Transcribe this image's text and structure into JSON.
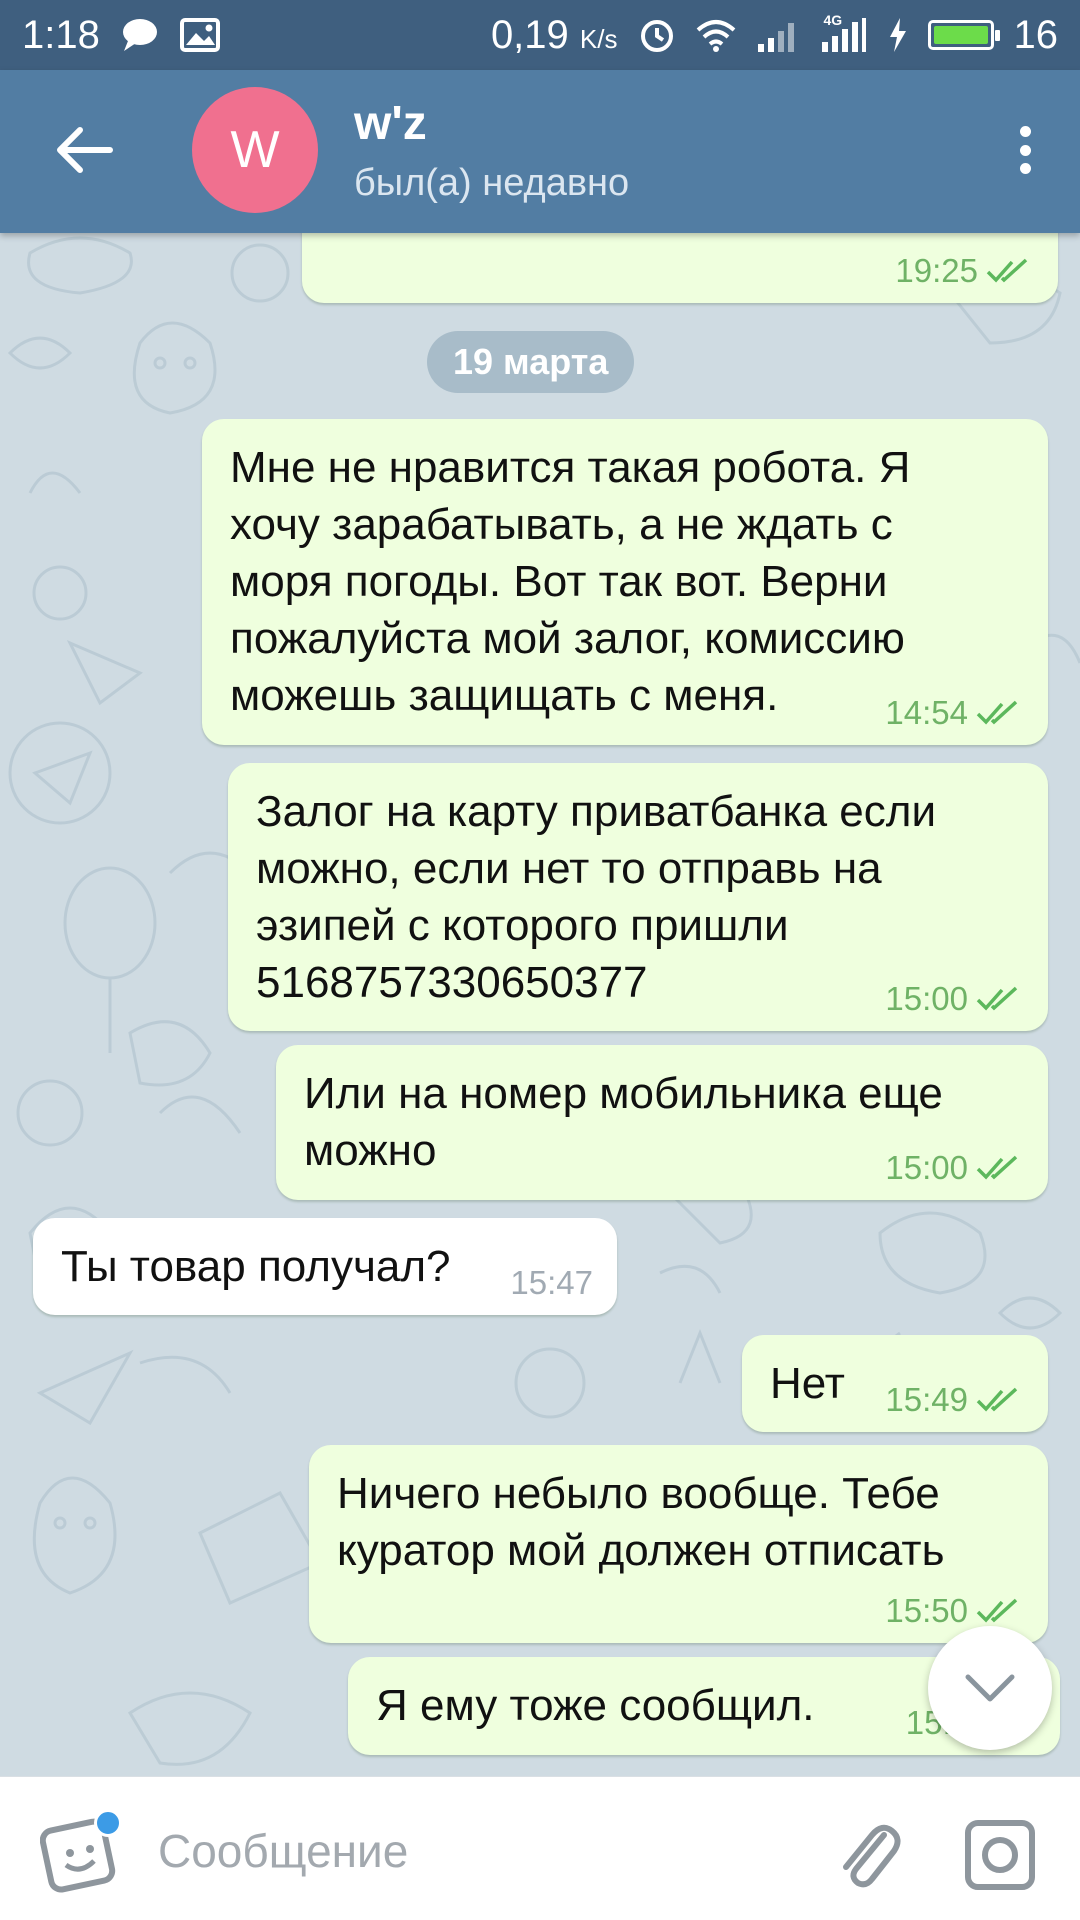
{
  "status_bar": {
    "time": "1:18",
    "network_speed": "0,19",
    "speed_unit": "K/s",
    "signal_label": "4G",
    "battery_level": "16",
    "battery_fraction": 0.16
  },
  "header": {
    "avatar_letter": "W",
    "contact_name": "w'z",
    "contact_status": "был(а) недавно"
  },
  "chat": {
    "date_separator": "19 марта",
    "messages": [
      {
        "direction": "out",
        "text": "",
        "time": "19:25"
      },
      {
        "direction": "out",
        "text": "Мне не нравится такая робота. Я хочу зарабатывать,  а не ждать с моря погоды.  Вот так вот. Верни пожалуйста мой залог,  комиссию можешь защищать с меня.",
        "time": "14:54"
      },
      {
        "direction": "out",
        "text": "Залог на карту приватбанка если можно,  если нет то отправь на эзипей с которого пришли 5168757330650377",
        "time": "15:00"
      },
      {
        "direction": "out",
        "text": "Или на номер мобильника еще можно",
        "time": "15:00"
      },
      {
        "direction": "in",
        "text": "Ты товар получал?",
        "time": "15:47"
      },
      {
        "direction": "out",
        "text": "Нет",
        "time": "15:49"
      },
      {
        "direction": "out",
        "text": "Ничего небыло вообще.  Тебе куратор мой должен отписать",
        "time": "15:50"
      },
      {
        "direction": "out",
        "text": "Я ему тоже сообщил.",
        "time": "15:5"
      }
    ]
  },
  "input": {
    "placeholder": "Сообщение"
  },
  "icons": {
    "back": "arrow-left-icon",
    "menu": "more-vertical-icon",
    "scroll_down": "chevron-down-icon",
    "sticker": "sticker-icon",
    "attach": "paperclip-icon",
    "camera": "camera-icon"
  },
  "colors": {
    "header": "#527da3",
    "status_bar": "#3f5f7f",
    "outgoing_bubble": "#efffde",
    "incoming_bubble": "#ffffff",
    "outgoing_time": "#6fb266",
    "avatar": "#f0708f",
    "unread_dot": "#3c9be6"
  }
}
